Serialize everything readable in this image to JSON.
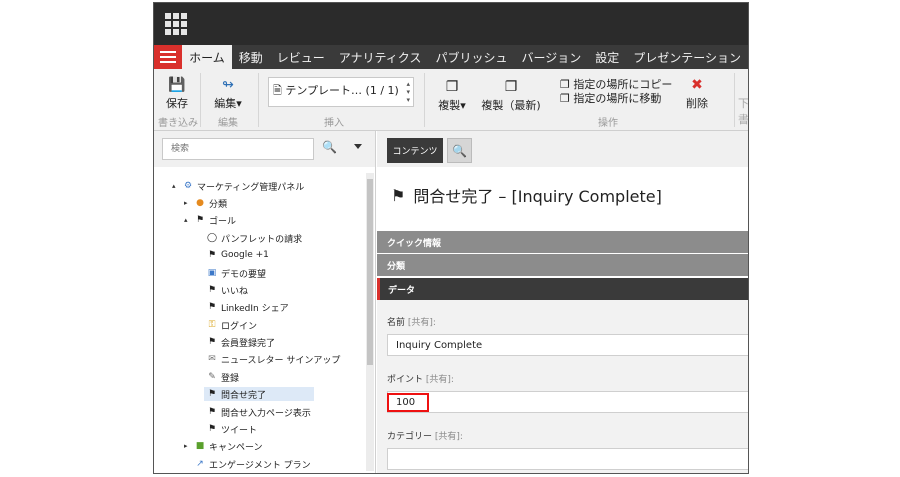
{
  "tabs": [
    "ホーム",
    "移動",
    "レビュー",
    "アナリティクス",
    "パブリッシュ",
    "バージョン",
    "設定",
    "プレゼンテーション"
  ],
  "ribbon": {
    "save": "保存",
    "edit": "編集▾",
    "template": "テンプレート…",
    "template_count": "(1 / 1)",
    "duplicate": "複製▾",
    "duplicate_latest": "複製（最新)",
    "copy_to": "指定の場所にコピー",
    "move_to": "指定の場所に移動",
    "delete": "削除",
    "partial": "下書",
    "groups": {
      "write": "書き込み",
      "edit": "編集",
      "insert": "挿入",
      "operation": "操作"
    }
  },
  "search": {
    "placeholder": "検索"
  },
  "tree": [
    {
      "label": "マーケティング管理パネル",
      "level": 0,
      "arrow": "▴"
    },
    {
      "label": "分類",
      "level": 1,
      "arrow": "▸"
    },
    {
      "label": "ゴール",
      "level": 1,
      "arrow": "▴"
    },
    {
      "label": "パンフレットの請求",
      "level": 2,
      "arrow": ""
    },
    {
      "label": "Google +1",
      "level": 2,
      "arrow": ""
    },
    {
      "label": "デモの要望",
      "level": 2,
      "arrow": ""
    },
    {
      "label": "いいね",
      "level": 2,
      "arrow": ""
    },
    {
      "label": "LinkedIn シェア",
      "level": 2,
      "arrow": ""
    },
    {
      "label": "ログイン",
      "level": 2,
      "arrow": ""
    },
    {
      "label": "会員登録完了",
      "level": 2,
      "arrow": ""
    },
    {
      "label": "ニュースレター サインアップ",
      "level": 2,
      "arrow": ""
    },
    {
      "label": "登録",
      "level": 2,
      "arrow": ""
    },
    {
      "label": "問合せ完了",
      "level": 2,
      "arrow": ""
    },
    {
      "label": "問合せ入力ページ表示",
      "level": 2,
      "arrow": ""
    },
    {
      "label": "ツイート",
      "level": 2,
      "arrow": ""
    },
    {
      "label": "キャンペーン",
      "level": 1,
      "arrow": "▸"
    },
    {
      "label": "エンゲージメント プラン",
      "level": 1,
      "arrow": ""
    }
  ],
  "editor": {
    "tab_contents": "コンテンツ",
    "title": "問合せ完了 – [Inquiry Complete]",
    "sections": {
      "quick_info": "クイック情報",
      "category": "分類",
      "data": "データ"
    },
    "fields": {
      "name_label": "名前",
      "points_label": "ポイント",
      "category_label": "カテゴリー",
      "shared": "[共有]:",
      "name_value": "Inquiry Complete",
      "points_value": "100",
      "category_value": ""
    }
  },
  "colors": {
    "accent": "#d9302c",
    "topbar": "#2b2b2b",
    "section": "#8c8c8c"
  }
}
